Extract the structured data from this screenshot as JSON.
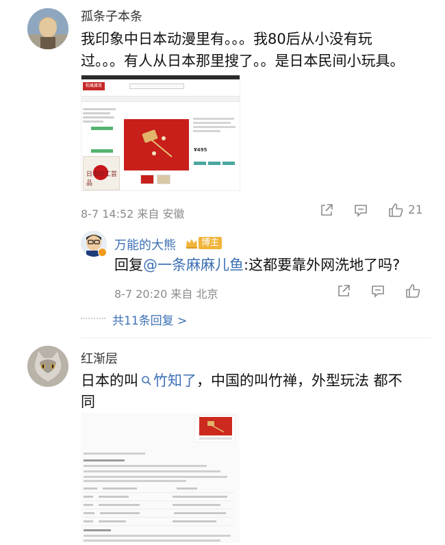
{
  "comments": [
    {
      "username": "孤条子本条",
      "text_line1": "我印象中日本动漫里有。。。我80后从小没有玩",
      "text_line2": "过。。。有人从日本那里搜了。。是日本民间小玩具。",
      "meta": "8-7 14:52 来自 安徽",
      "like_count": "21",
      "screenshot": {
        "logo": "和風雑貨",
        "ad_text": "日本の工芸品",
        "price": "¥495"
      }
    },
    {
      "username": "红渐层",
      "text_part1": "日本的叫",
      "link_text": "竹知了",
      "text_part2": "，中国的叫竹禅，外型玩法 都不",
      "text_line2": "同"
    }
  ],
  "reply": {
    "username": "万能的大熊",
    "badge": "博主",
    "prefix": "回复",
    "mention": "@一条麻麻儿鱼",
    "text": ":这都要靠外网洗地了吗?",
    "meta": "8-7 20:20 来自 北京",
    "more": "共11条回复 >"
  },
  "colors": {
    "link": "#3b6fb5",
    "badge_bg": "#f0b43a",
    "meta": "#8a8a8a"
  }
}
